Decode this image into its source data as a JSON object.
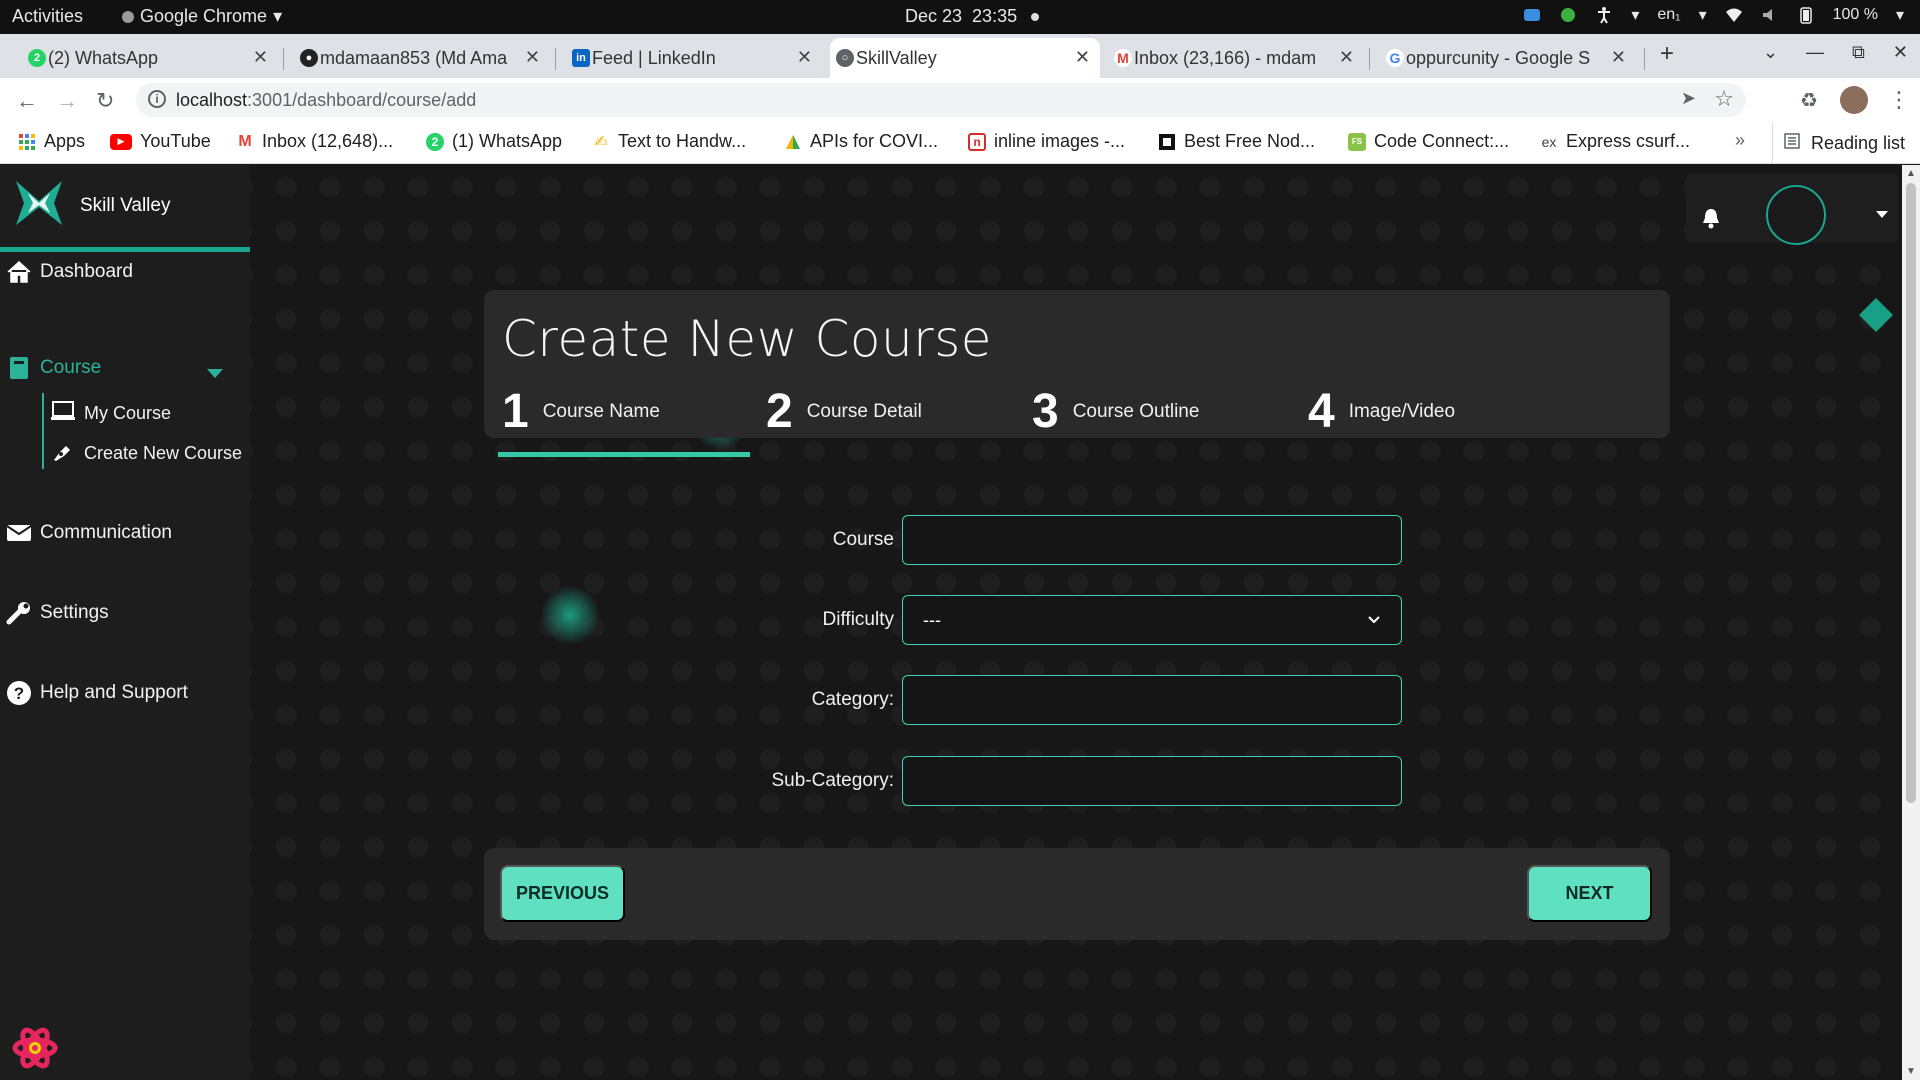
{
  "os": {
    "activities": "Activities",
    "app_name": "Google Chrome",
    "date": "Dec 23",
    "time": "23:35",
    "lang": "en₁",
    "battery": "100 %"
  },
  "tabs": [
    {
      "title": "(2) WhatsApp",
      "icon": "whatsapp-icon",
      "color": "#25d366"
    },
    {
      "title": "mdamaan853 (Md Ama",
      "icon": "github-icon",
      "color": "#222222"
    },
    {
      "title": "Feed | LinkedIn",
      "icon": "linkedin-icon",
      "color": "#0a66c2"
    },
    {
      "title": "SkillValley",
      "icon": "globe-icon",
      "color": "#5f6368"
    },
    {
      "title": "Inbox (23,166) - mdam",
      "icon": "gmail-icon",
      "color": "#ea4335"
    },
    {
      "title": "oppurcunity - Google S",
      "icon": "google-icon",
      "color": "#4285f4"
    }
  ],
  "address": {
    "host": "localhost",
    "path": ":3001/dashboard/course/add"
  },
  "bookmarks": [
    {
      "label": "Apps"
    },
    {
      "label": "YouTube"
    },
    {
      "label": "Inbox (12,648)..."
    },
    {
      "label": "(1) WhatsApp"
    },
    {
      "label": "Text to Handw..."
    },
    {
      "label": "APIs for COVI..."
    },
    {
      "label": "inline images -..."
    },
    {
      "label": "Best Free Nod..."
    },
    {
      "label": "Code Connect:..."
    },
    {
      "label": "Express csurf..."
    }
  ],
  "bookmarks_more": "»",
  "reading_list": "Reading list",
  "brand": {
    "name": "Skill Valley",
    "accent": "#1aa68f"
  },
  "sidebar": {
    "dashboard": "Dashboard",
    "course": "Course",
    "my_course": "My Course",
    "create_course": "Create New Course",
    "communication": "Communication",
    "settings": "Settings",
    "help": "Help and Support"
  },
  "wizard": {
    "title": "Create New Course",
    "steps": [
      {
        "num": "1",
        "label": "Course Name"
      },
      {
        "num": "2",
        "label": "Course Detail"
      },
      {
        "num": "3",
        "label": "Course Outline"
      },
      {
        "num": "4",
        "label": "Image/Video"
      }
    ]
  },
  "form": {
    "course_label": "Course",
    "course_value": "",
    "difficulty_label": "Difficulty",
    "difficulty_value": "---",
    "category_label": "Category:",
    "category_value": "",
    "subcategory_label": "Sub-Category:",
    "subcategory_value": ""
  },
  "actions": {
    "previous": "PREVIOUS",
    "next": "NEXT"
  }
}
